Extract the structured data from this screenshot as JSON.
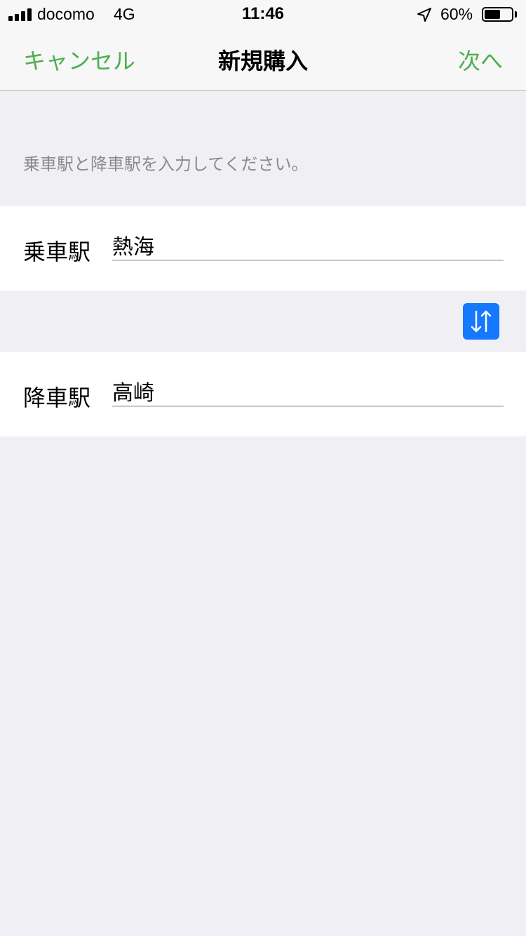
{
  "status_bar": {
    "carrier": "docomo",
    "network": "4G",
    "time": "11:46",
    "battery_percent_text": "60%",
    "battery_level": 0.6,
    "icons": [
      "signal-bars-icon",
      "location-arrow-icon",
      "battery-icon"
    ]
  },
  "nav": {
    "cancel_label": "キャンセル",
    "title": "新規購入",
    "next_label": "次へ"
  },
  "form": {
    "instruction": "乗車駅と降車駅を入力してください。",
    "departure": {
      "label": "乗車駅",
      "value": "熱海"
    },
    "arrival": {
      "label": "降車駅",
      "value": "高崎"
    },
    "swap_icon": "swap-vertical-arrows-icon"
  },
  "colors": {
    "accent_green": "#4caf50",
    "swap_blue": "#1479ff",
    "background": "#efeff4"
  }
}
